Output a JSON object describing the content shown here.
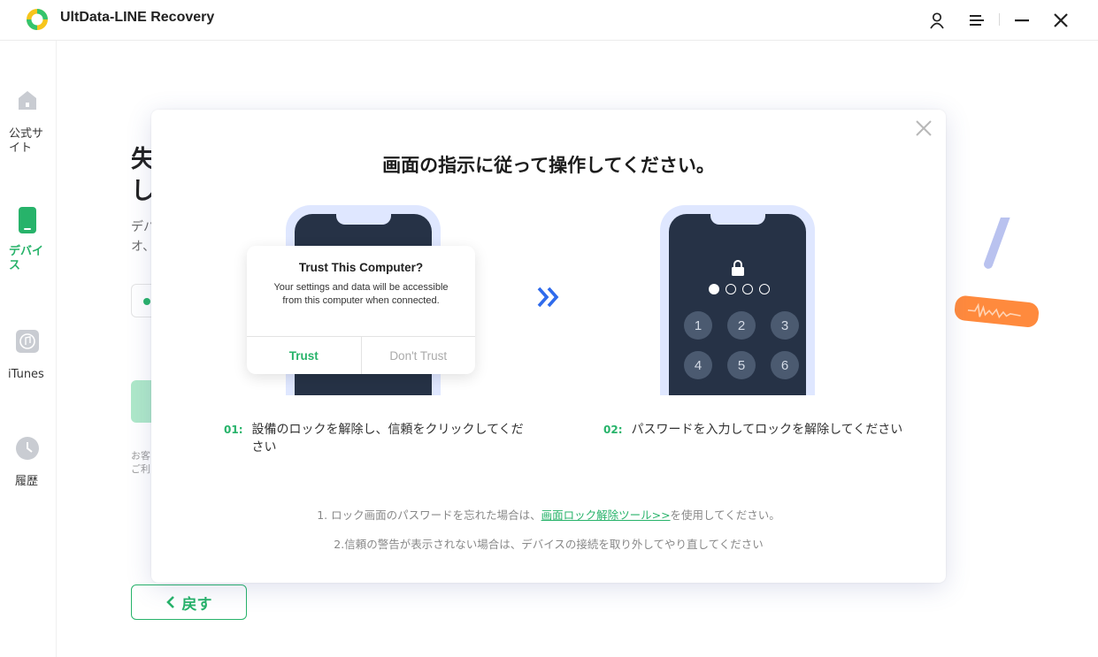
{
  "app": {
    "title": "UltData-LINE Recovery"
  },
  "sidebar": {
    "items": [
      {
        "label": "公式サイト",
        "icon": "home-icon",
        "active": false
      },
      {
        "label": "デバイス",
        "icon": "phone-icon",
        "active": true
      },
      {
        "label": "iTunes",
        "icon": "itunes-icon",
        "active": false
      },
      {
        "label": "履歴",
        "icon": "clock-icon",
        "active": false
      }
    ]
  },
  "background": {
    "heading": "失し",
    "desc": "デバオ、",
    "small": "お客ご利",
    "back_label": "戻す"
  },
  "modal": {
    "title": "画面の指示に従って操作してください。",
    "trust_dialog": {
      "title": "Trust This Computer?",
      "message": "Your settings and data will be accessible from this computer when connected.",
      "trust_label": "Trust",
      "dont_trust_label": "Don't Trust"
    },
    "keypad": [
      "1",
      "2",
      "3",
      "4",
      "5",
      "6"
    ],
    "steps": [
      {
        "num": "01:",
        "text": "設備のロックを解除し、信頼をクリックしてください"
      },
      {
        "num": "02:",
        "text": "パスワードを入力してロックを解除してください"
      }
    ],
    "note1_prefix": "1. ロック画面のパスワードを忘れた場合は、",
    "note1_link": "画面ロック解除ツール>>",
    "note1_suffix": "を使用してください。",
    "note2": "2.信頼の警告が表示されない場合は、デバイスの接続を取り外してやり直してください"
  },
  "colors": {
    "accent": "#27b36a",
    "arrows": "#2f6bec",
    "phone_screen": "#263246",
    "phone_frame": "#dfe7ff"
  }
}
